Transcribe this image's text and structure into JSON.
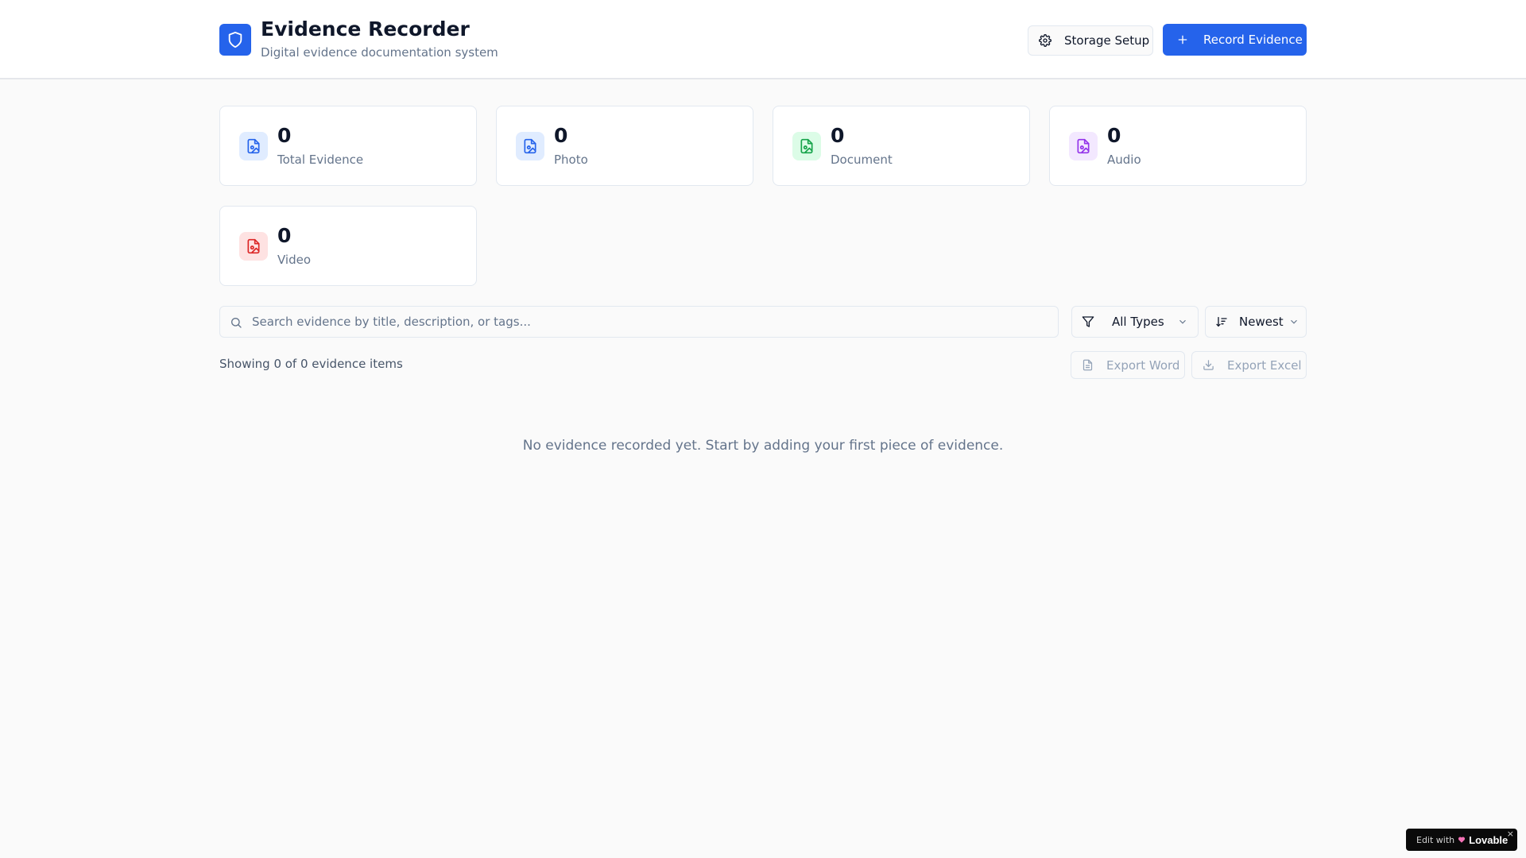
{
  "header": {
    "title": "Evidence Recorder",
    "subtitle": "Digital evidence documentation system",
    "logo_icon": "shield-icon",
    "storage_button": "Storage Setup",
    "record_button": "Record Evidence"
  },
  "stats": [
    {
      "count": "0",
      "label": "Total Evidence",
      "icon": "file-image-icon",
      "color": "#2563eb",
      "bg": "#e0ecff"
    },
    {
      "count": "0",
      "label": "Photo",
      "icon": "file-image-icon",
      "color": "#2563eb",
      "bg": "#e0ecff"
    },
    {
      "count": "0",
      "label": "Document",
      "icon": "file-image-icon",
      "color": "#16a34a",
      "bg": "#dcfce7"
    },
    {
      "count": "0",
      "label": "Audio",
      "icon": "file-image-icon",
      "color": "#9333ea",
      "bg": "#f3e8ff"
    },
    {
      "count": "0",
      "label": "Video",
      "icon": "file-image-icon",
      "color": "#dc2626",
      "bg": "#fee2e2"
    }
  ],
  "search": {
    "placeholder": "Search evidence by title, description, or tags...",
    "value": ""
  },
  "filters": {
    "type_selected": "All Types",
    "sort_selected": "Newest"
  },
  "results": {
    "showing_text": "Showing 0 of 0 evidence items",
    "export_word": "Export Word",
    "export_excel": "Export Excel",
    "empty_message": "No evidence recorded yet. Start by adding your first piece of evidence."
  },
  "badge": {
    "edit_text": "Edit with",
    "brand": "Lovable",
    "close": "×"
  },
  "colors": {
    "accent": "#2563eb",
    "background": "#fafafa"
  }
}
